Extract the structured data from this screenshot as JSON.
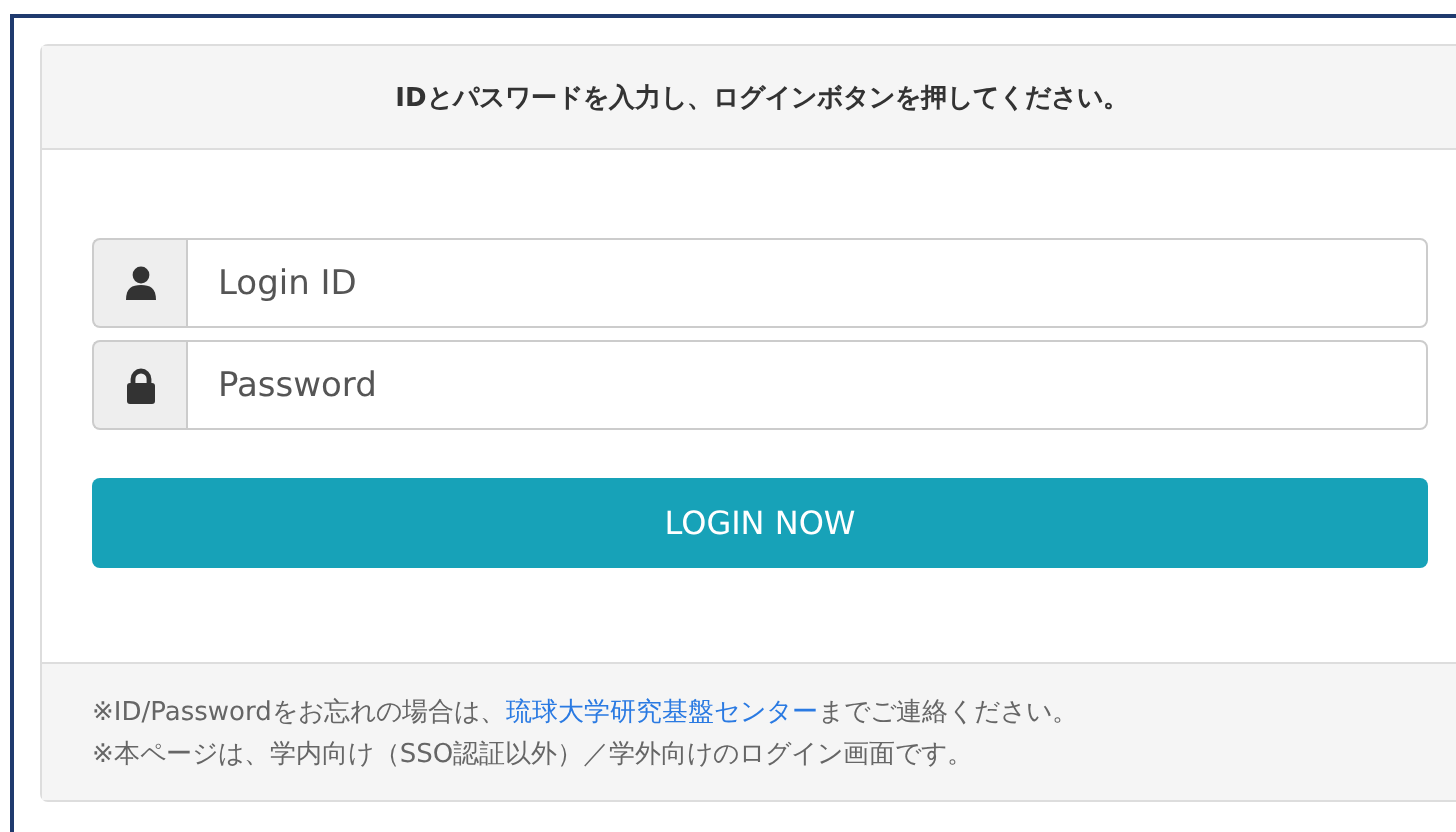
{
  "header": {
    "title": "IDとパスワードを入力し、ログインボタンを押してください。"
  },
  "fields": [
    {
      "kind": "user",
      "placeholder": "Login ID"
    },
    {
      "kind": "lock",
      "placeholder": "Password"
    }
  ],
  "button": {
    "label": "LOGIN NOW"
  },
  "footer": {
    "notes": [
      {
        "before": "※ID/Passwordをお忘れの場合は、",
        "link": "琉球大学研究基盤センター",
        "after": "までご連絡ください。"
      },
      {
        "before": "※本ページは、学内向け（SSO認証以外）／学外向けのログイン画面です。"
      }
    ]
  }
}
